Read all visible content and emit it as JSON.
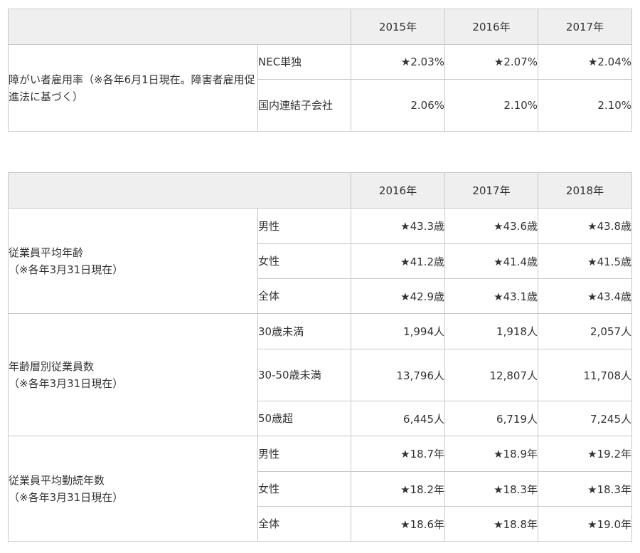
{
  "table1": {
    "years": [
      "2015年",
      "2016年",
      "2017年"
    ],
    "category": "障がい者雇用率（※各年6月1日現在。障害者雇用促進法に基づく）",
    "rows": [
      {
        "label": "NEC単独",
        "values": [
          "★2.03%",
          "★2.07%",
          "★2.04%"
        ]
      },
      {
        "label": "国内連結子会社",
        "values": [
          "2.06%",
          "2.10%",
          "2.10%"
        ]
      }
    ]
  },
  "table2": {
    "years": [
      "2016年",
      "2017年",
      "2018年"
    ],
    "groups": [
      {
        "category": "従業員平均年齢",
        "note": "（※各年3月31日現在）",
        "rows": [
          {
            "label": "男性",
            "values": [
              "★43.3歳",
              "★43.6歳",
              "★43.8歳"
            ]
          },
          {
            "label": "女性",
            "values": [
              "★41.2歳",
              "★41.4歳",
              "★41.5歳"
            ]
          },
          {
            "label": "全体",
            "values": [
              "★42.9歳",
              "★43.1歳",
              "★43.4歳"
            ]
          }
        ]
      },
      {
        "category": "年齢層別従業員数",
        "note": "（※各年3月31日現在）",
        "rows": [
          {
            "label": "30歳未満",
            "values": [
              "1,994人",
              "1,918人",
              "2,057人"
            ]
          },
          {
            "label": "30-50歳未満",
            "values": [
              "13,796人",
              "12,807人",
              "11,708人"
            ]
          },
          {
            "label": "50歳超",
            "values": [
              "6,445人",
              "6,719人",
              "7,245人"
            ]
          }
        ]
      },
      {
        "category": "従業員平均勤続年数",
        "note": "（※各年3月31日現在）",
        "rows": [
          {
            "label": "男性",
            "values": [
              "★18.7年",
              "★18.9年",
              "★19.2年"
            ]
          },
          {
            "label": "女性",
            "values": [
              "★18.2年",
              "★18.3年",
              "★18.3年"
            ]
          },
          {
            "label": "全体",
            "values": [
              "★18.6年",
              "★18.8年",
              "★19.0年"
            ]
          }
        ]
      }
    ]
  }
}
